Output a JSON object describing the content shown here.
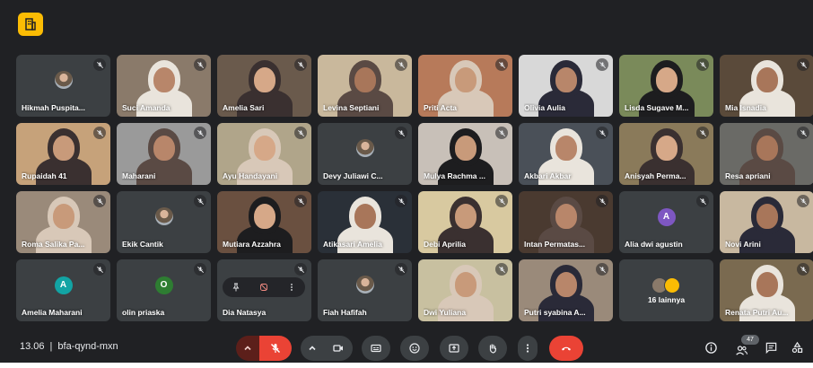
{
  "participants": [
    {
      "name": "Hikmah Puspita...",
      "type": "avatar-img",
      "bg": "#3c4043"
    },
    {
      "name": "Suci Amanda",
      "type": "video",
      "bg": "#8a7a6a"
    },
    {
      "name": "Amelia Sari",
      "type": "video",
      "bg": "#6a5a4c"
    },
    {
      "name": "Levina Septiani",
      "type": "video",
      "bg": "#c9b89c"
    },
    {
      "name": "Priti Acta",
      "type": "video",
      "bg": "#b77a5a"
    },
    {
      "name": "Olivia Aulia",
      "type": "video",
      "bg": "#d8d8d8"
    },
    {
      "name": "Lisda Sugave M...",
      "type": "video",
      "bg": "#7a8a5a"
    },
    {
      "name": "Mia Isnadia",
      "type": "video",
      "bg": "#5a4a3a"
    },
    {
      "name": "Rupaidah 41",
      "type": "video",
      "bg": "#c6a27a"
    },
    {
      "name": "Maharani",
      "type": "video",
      "bg": "#9a9a9a"
    },
    {
      "name": "Ayu Handayani",
      "type": "video",
      "bg": "#b0a58a"
    },
    {
      "name": "Devy Juliawi C...",
      "type": "avatar-img",
      "bg": "#3c4043"
    },
    {
      "name": "Mulya Rachma ...",
      "type": "video",
      "bg": "#c8c0b8"
    },
    {
      "name": "Akbari Akbar",
      "type": "video",
      "bg": "#4a5058"
    },
    {
      "name": "Anisyah Perma...",
      "type": "video",
      "bg": "#8a7a5a"
    },
    {
      "name": "Resa apriani",
      "type": "video",
      "bg": "#6a6a66"
    },
    {
      "name": "Roma Salika Pa...",
      "type": "video",
      "bg": "#9a8a7a"
    },
    {
      "name": "Ekik Cantik",
      "type": "avatar-img",
      "bg": "#3c4043"
    },
    {
      "name": "Mutiara Azzahra",
      "type": "video",
      "bg": "#6a5040"
    },
    {
      "name": "Atikasari Amelia",
      "type": "video",
      "bg": "#2a3038"
    },
    {
      "name": "Debi Aprilia",
      "type": "video",
      "bg": "#d8c9a0"
    },
    {
      "name": "Intan Permatas...",
      "type": "video",
      "bg": "#4a3a30"
    },
    {
      "name": "Alia dwi agustin",
      "type": "letter",
      "letter": "A",
      "bg": "#3c4043",
      "color": "#7e57c2"
    },
    {
      "name": "Novi Arini",
      "type": "video",
      "bg": "#c8b8a0"
    },
    {
      "name": "Amelia Maharani",
      "type": "letter",
      "letter": "A",
      "bg": "#3c4043",
      "color": "#12a4a4"
    },
    {
      "name": "olin priaska",
      "type": "letter",
      "letter": "O",
      "bg": "#3c4043",
      "color": "#2e7d32"
    },
    {
      "name": "Dia Natasya",
      "type": "hover",
      "bg": "#3c4043"
    },
    {
      "name": "Fiah Hafifah",
      "type": "avatar-img",
      "bg": "#3c4043"
    },
    {
      "name": "Dwi Yuliana",
      "type": "video",
      "bg": "#c8c0a0"
    },
    {
      "name": "Putri syabina A...",
      "type": "video",
      "bg": "#9a8a7a"
    },
    {
      "name": "16 lainnya",
      "type": "others",
      "bg": "#3c4043"
    },
    {
      "name": "Renata Putri Au...",
      "type": "video",
      "bg": "#7a6a50"
    }
  ],
  "meeting": {
    "time": "13.06",
    "code": "bfa-qynd-mxn"
  },
  "people_count": "47",
  "colors": {
    "background": "#202124",
    "tile": "#3c4043",
    "end_call": "#ea4335",
    "badge": "#fbbc04"
  },
  "icons": {
    "mic": "mic-off-icon",
    "camera": "videocam-icon",
    "captions": "closed-caption-icon",
    "reactions": "emoji-icon",
    "present": "present-icon",
    "hand": "raise-hand-icon",
    "more": "more-vert-icon",
    "end": "call-end-icon",
    "info": "info-icon",
    "people": "people-icon",
    "chat": "chat-icon",
    "activities": "activities-icon"
  }
}
